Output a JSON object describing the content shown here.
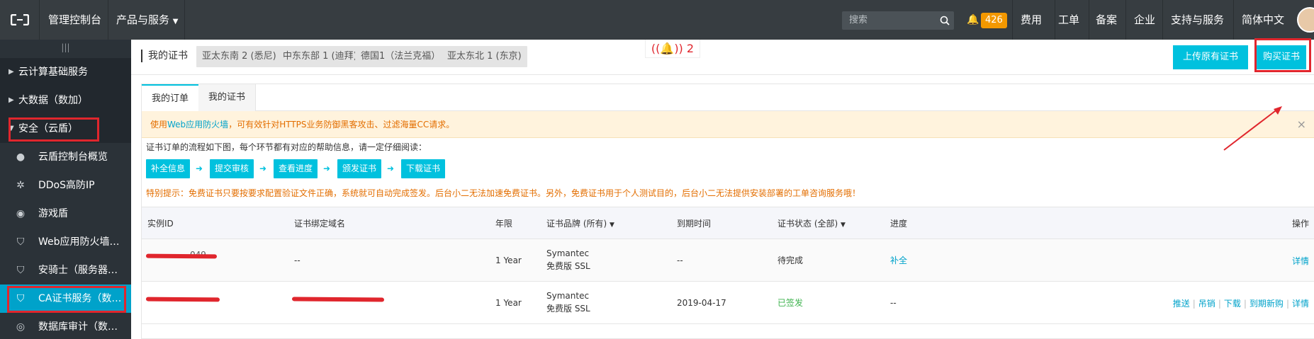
{
  "topbar": {
    "console_label": "管理控制台",
    "products_label": "产品与服务",
    "search_placeholder": "搜索",
    "notification_count": "426",
    "nav": [
      "费用",
      "工单",
      "备案",
      "企业",
      "支持与服务",
      "简体中文"
    ]
  },
  "sidebar": {
    "grip": "|||",
    "categories": [
      "云计算基础服务",
      "大数据（数加）",
      "安全（云盾）"
    ],
    "items": [
      "云盾控制台概览",
      "DDoS高防IP",
      "游戏盾",
      "Web应用防火墙（网络...",
      "安骑士（服务器安全）",
      "CA证书服务（数据安...",
      "数据库审计（数据安全..."
    ]
  },
  "header": {
    "title": "我的证书",
    "regions": [
      "亚太东南 2 (悉尼)",
      "中东东部 1 (迪拜)",
      "德国1（法兰克福）",
      "亚太东北 1 (东京)"
    ],
    "notif_count": "2",
    "upload_button": "上传原有证书",
    "buy_button": "购买证书"
  },
  "tabs": [
    "我的订单",
    "我的证书"
  ],
  "warning": {
    "prefix": "使用",
    "link": "Web应用防火墙",
    "suffix": "，可有效针对HTTPS业务防御黑客攻击、过滤海量CC请求。",
    "close": "×"
  },
  "flow": {
    "intro": "证书订单的流程如下图，每个环节都有对应的帮助信息，请一定仔细阅读：",
    "steps": [
      "补全信息",
      "提交审核",
      "查看进度",
      "颁发证书",
      "下载证书"
    ],
    "tip": "特别提示：免费证书只要按要求配置验证文件正确，系统就可自动完成签发。后台小二无法加速免费证书。另外，免费证书用于个人测试目的，后台小二无法提供安装部署的工单咨询服务哦！"
  },
  "table": {
    "headers": [
      "实例ID",
      "证书绑定域名",
      "年限",
      "证书品牌 (所有)",
      "到期时间",
      "证书状态 (全部)",
      "进度",
      "操作"
    ],
    "rows": [
      {
        "id": "049",
        "domain": "--",
        "years": "1 Year",
        "brand": "Symantec",
        "brand_type": "免费版 SSL",
        "expiry": "--",
        "status": "待完成",
        "progress": "补全",
        "actions": [
          "详情"
        ]
      },
      {
        "id": "",
        "domain": "",
        "years": "1 Year",
        "brand": "Symantec",
        "brand_type": "免费版 SSL",
        "expiry": "2019-04-17",
        "status": "已签发",
        "progress": "--",
        "actions": [
          "推送",
          "吊销",
          "下载",
          "到期新购",
          "详情"
        ]
      }
    ]
  },
  "colors": {
    "accent": "#00c1de",
    "annotation": "#e0262d",
    "warning_text": "#e36e00",
    "topbar": "#373d41",
    "sidebar": "#22282e"
  }
}
